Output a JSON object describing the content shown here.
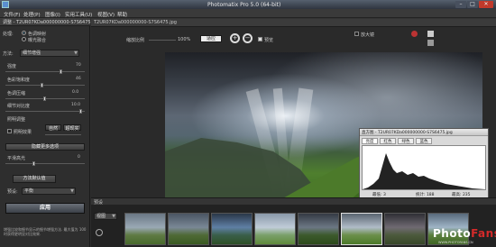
{
  "window": {
    "title": "Photomatix Pro 5.0 (64-bit)",
    "min": "–",
    "max": "□",
    "close": "✕"
  },
  "menu": [
    "文件(F)",
    "处理(P)",
    "图像(I)",
    "实用工具(U)",
    "视图(V)",
    "帮助"
  ],
  "panel": {
    "header": "调整 - T2UR07KDa000000000-S7S6475.jpg",
    "process_label": "处理:",
    "process_options": [
      "色调映射",
      "曝光融合"
    ],
    "method_label": "方法:",
    "method_value": "细节增强",
    "sliders": [
      {
        "label": "强度",
        "value": "70"
      },
      {
        "label": "色彩饱和度",
        "value": "46"
      },
      {
        "label": "色调压缩",
        "value": "0.0"
      },
      {
        "label": "细节对比度",
        "value": "10.0"
      }
    ],
    "lighting_label": "照明调整",
    "lighting_buttons": [
      "自然",
      "超现实"
    ],
    "lighting_check": "照明效果",
    "show_more": "隐藏更多选项",
    "smooth_label": "平滑高光",
    "smooth_value": "0",
    "reset": "方法默认值",
    "preset_label": "预设:",
    "preset_value": "平衡",
    "apply": "应用",
    "hint": "增强比较和细节显示的细节增强方法. 最大值为 100 时获得更明显对比效果."
  },
  "toolbar": {
    "zoom_label": "缩放比例",
    "zoom_value": "100%",
    "fit": "适应",
    "preview_check": "预览",
    "loupe": "放大镜"
  },
  "document": {
    "name": "T2UR07KDa000000000-S7S6475.jpg"
  },
  "histogram": {
    "title": "直方图 - T2UR07KDa000000000-S7S6475.jpg",
    "tabs": [
      "亮度",
      "红色",
      "绿色",
      "蓝色"
    ],
    "stats": [
      "最低: 3",
      "统计: 188",
      "最高: 235"
    ]
  },
  "film": {
    "label": "预设",
    "view_select": "视图",
    "count": 8
  },
  "watermark": {
    "main_a": "Photo",
    "main_b": "Fans",
    "sub": "WWW.PHOTOFANS.CN"
  }
}
